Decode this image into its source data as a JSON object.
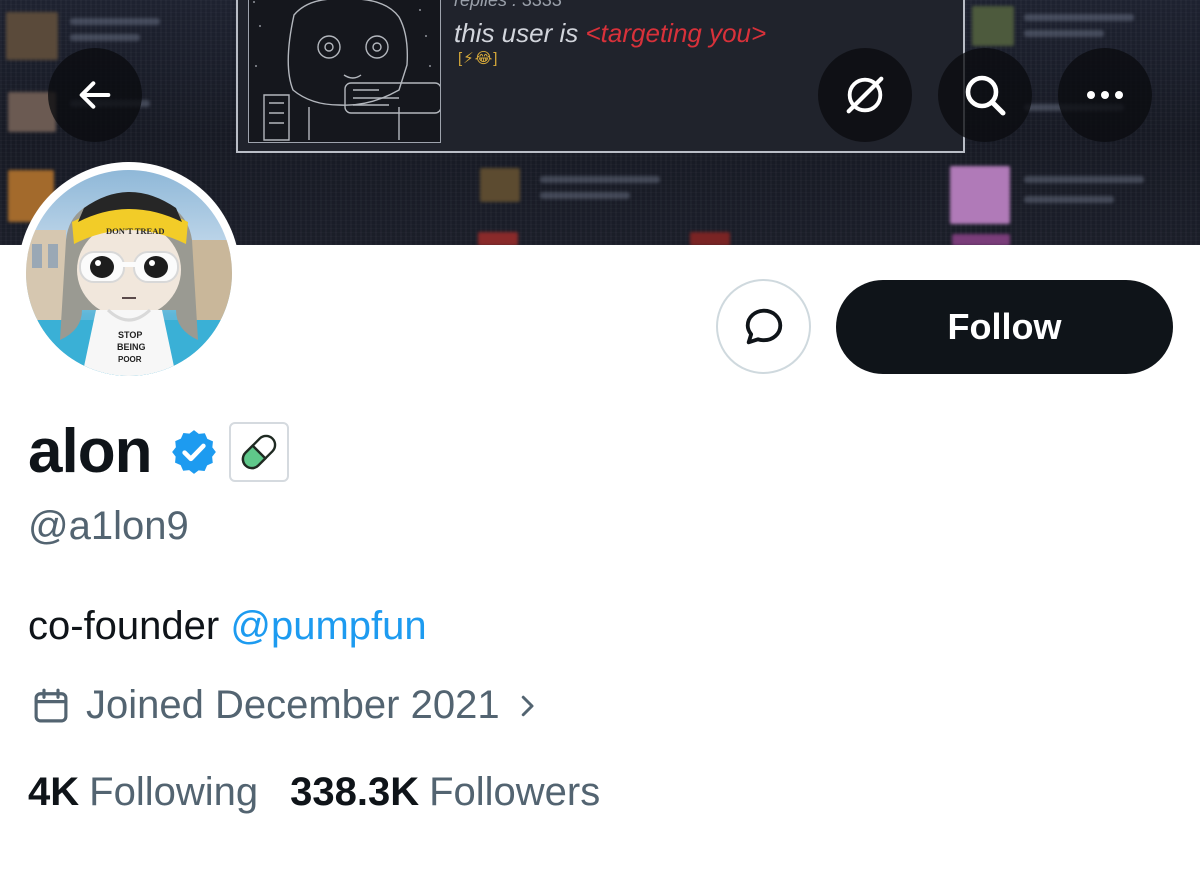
{
  "banner": {
    "meta_text": "replies : 3333",
    "line_prefix": "this user is ",
    "line_highlight": "<targeting you>",
    "emoji_row": "[⚡😂]"
  },
  "nav": {
    "back_icon": "arrow-left-icon",
    "grok_icon": "grok-icon",
    "search_icon": "search-icon",
    "more_icon": "more-horizontal-icon"
  },
  "avatar": {
    "hat_text": "DON'T TREAD",
    "shirt_text_1": "STOP",
    "shirt_text_2": "BEING",
    "shirt_text_3": "POOR"
  },
  "actions": {
    "message_icon": "message-bubble-icon",
    "follow_label": "Follow"
  },
  "profile": {
    "display_name": "alon",
    "verified_icon": "verified-badge-icon",
    "affiliate_icon": "pill-icon",
    "handle": "@a1lon9",
    "bio_prefix": "co-founder ",
    "bio_mention": "@pumpfun",
    "joined": "Joined December 2021",
    "following_count": "4K",
    "following_label": "Following",
    "followers_count": "338.3K",
    "followers_label": "Followers"
  },
  "colors": {
    "accent": "#1d9bf0",
    "text_primary": "#0f1419",
    "text_secondary": "#536471",
    "follow_bg": "#0f1419",
    "highlight_red": "#d8313a"
  }
}
